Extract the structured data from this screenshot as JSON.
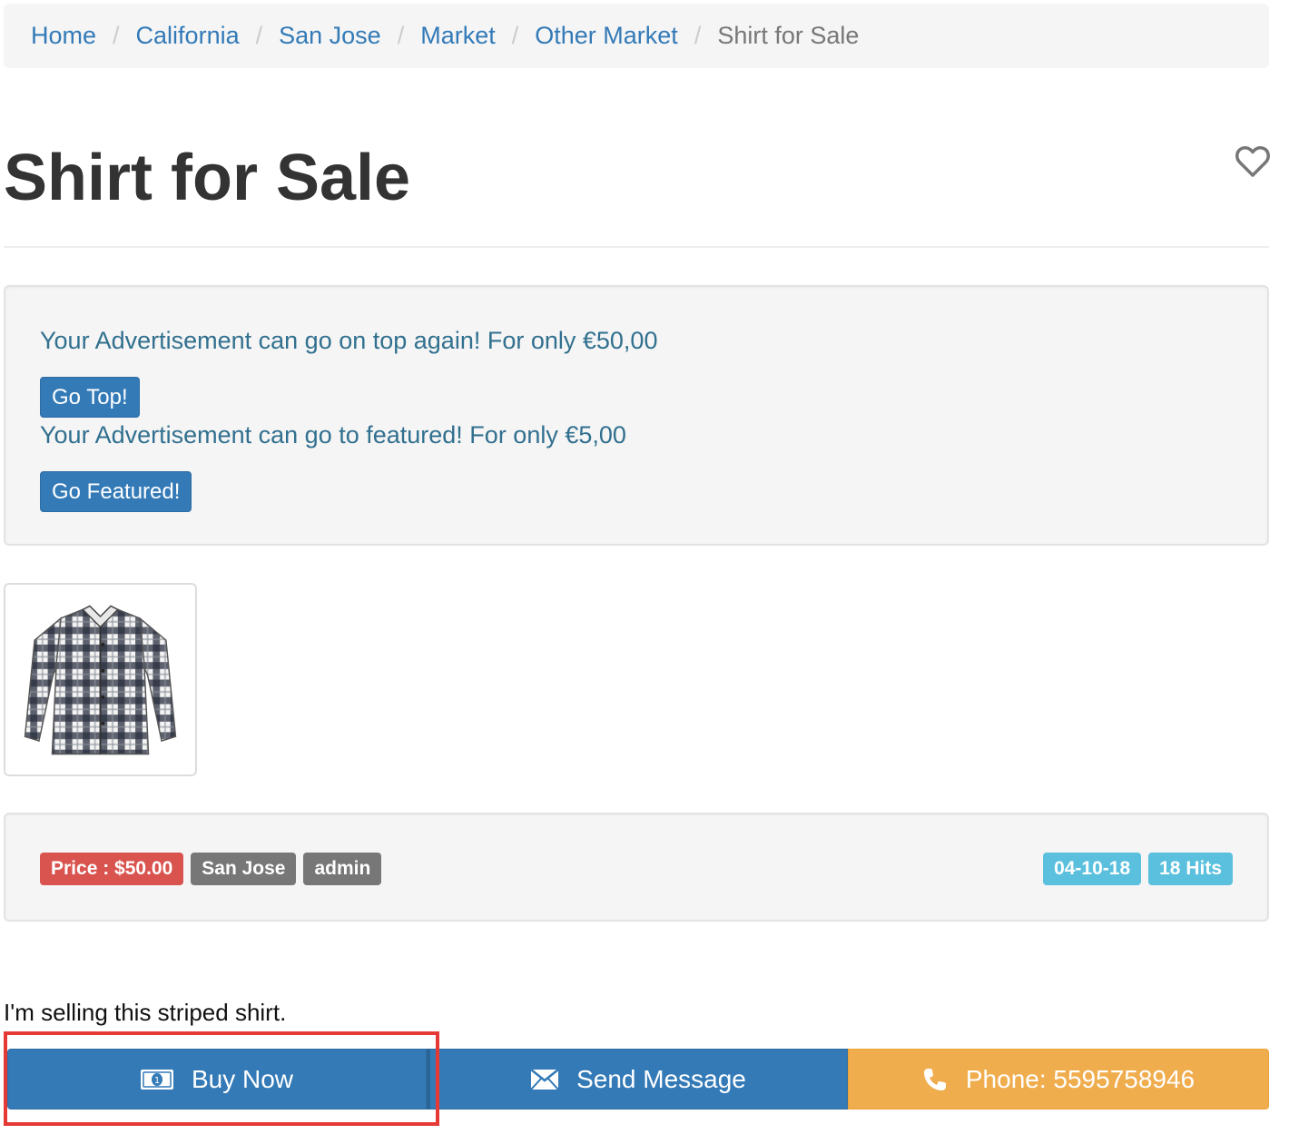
{
  "breadcrumb": {
    "items": [
      "Home",
      "California",
      "San Jose",
      "Market",
      "Other Market"
    ],
    "separator": "/",
    "current": "Shirt for Sale"
  },
  "listing": {
    "title": "Shirt for Sale",
    "description": "I'm selling this striped shirt."
  },
  "promo": {
    "top_text": "Your Advertisement can go on top again! For only €50,00",
    "top_button": "Go Top!",
    "featured_text": "Your Advertisement can go to featured! For only €5,00",
    "featured_button": "Go Featured!"
  },
  "info": {
    "price": "Price : $50.00",
    "location": "San Jose",
    "author": "admin",
    "date": "04-10-18",
    "hits": "18 Hits"
  },
  "actions": {
    "buy": "Buy Now",
    "message": "Send Message",
    "phone": "Phone: 5595758946"
  },
  "icons": {
    "favorite": "heart-outline-icon",
    "buy": "money-bill-icon",
    "message": "envelope-icon",
    "phone": "phone-icon"
  },
  "colors": {
    "primary": "#337ab7",
    "warning": "#f0ad4e",
    "danger": "#d9534f",
    "info": "#5bc0de",
    "default": "#777777",
    "highlight": "#e53935"
  }
}
